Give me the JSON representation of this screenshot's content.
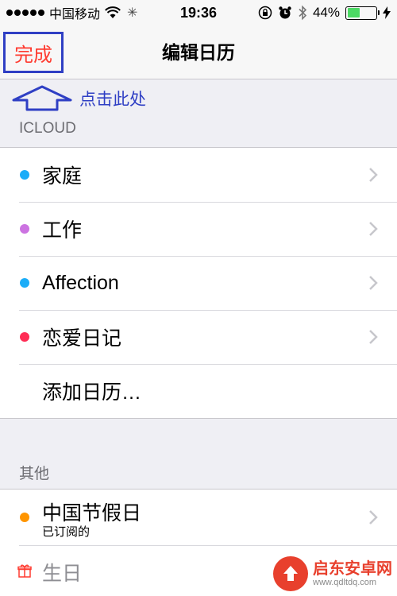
{
  "status_bar": {
    "carrier": "中国移动",
    "time": "19:36",
    "battery_percent": "44%",
    "battery_level": 0.44,
    "battery_color": "#4cd964"
  },
  "nav": {
    "done_label": "完成",
    "title": "编辑日历"
  },
  "annotation": {
    "text": "点击此处",
    "color": "#2f3fc4"
  },
  "icloud": {
    "header": "ICLOUD",
    "calendars": [
      {
        "label": "家庭",
        "color": "#1badf8"
      },
      {
        "label": "工作",
        "color": "#cc73e1"
      },
      {
        "label": "Affection",
        "color": "#1badf8"
      },
      {
        "label": "恋爱日记",
        "color": "#ff2d55"
      }
    ],
    "add_label": "添加日历…"
  },
  "other": {
    "header": "其他",
    "holiday": {
      "label": "中国节假日",
      "subtitle": "已订阅的",
      "color": "#ff9500"
    },
    "birthday": {
      "label": "生日",
      "icon": "gift-icon"
    }
  },
  "watermark": {
    "title": "启东安卓网",
    "url": "www.qdltdq.com"
  }
}
